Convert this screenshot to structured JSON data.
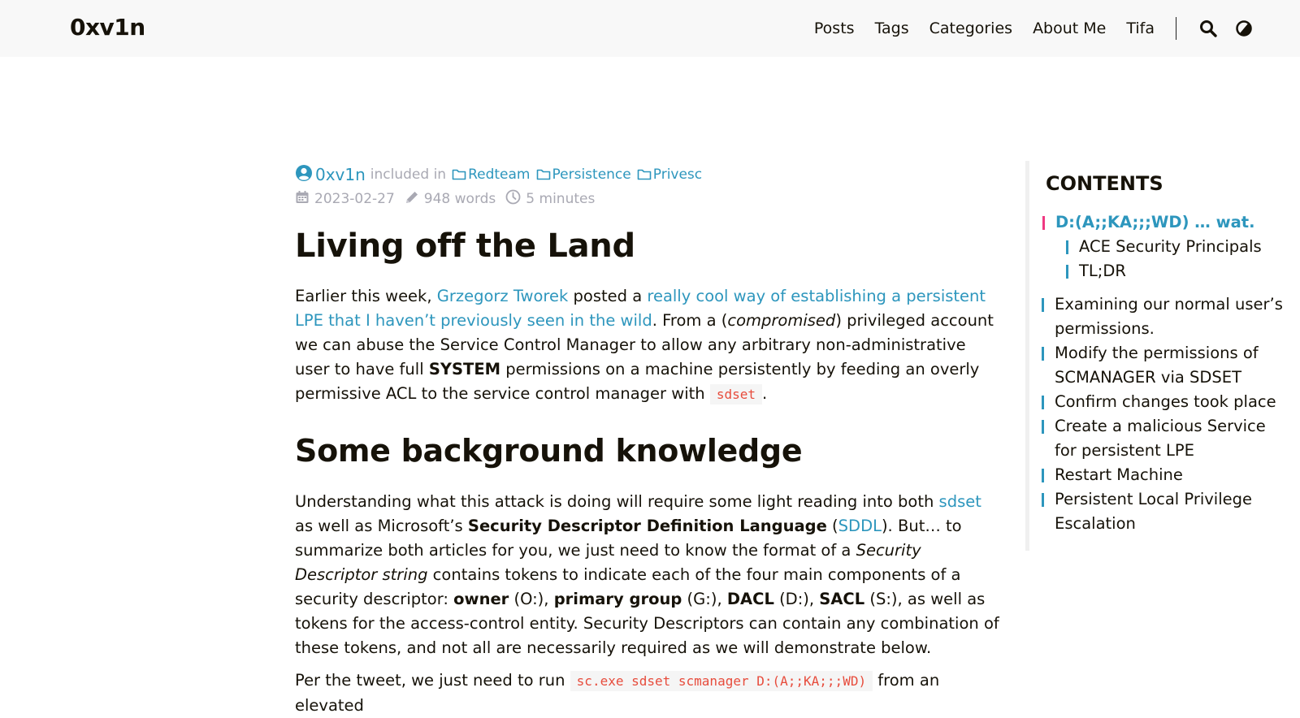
{
  "header": {
    "logo": "0xv1n",
    "menu": [
      "Posts",
      "Tags",
      "Categories",
      "About Me",
      "Tifa"
    ]
  },
  "meta": {
    "author": "0xv1n",
    "included_in": "included in",
    "categories": [
      "Redteam",
      "Persistence",
      "Privesc"
    ],
    "date": "2023-02-27",
    "words": "948 words",
    "reading_time": "5 minutes"
  },
  "article": {
    "title": "Living off the Land",
    "p1": {
      "a": "Earlier this week, ",
      "link1": "Grzegorz Tworek",
      "b": " posted a ",
      "link2": "really cool way of establishing a persistent LPE that I haven’t previously seen in the wild",
      "c": ". From a (",
      "em": "compromised",
      "d": ") privileged account we can abuse the Service Control Manager to allow any arbitrary non-administrative user to have full ",
      "strong": "SYSTEM",
      "e": " permissions on a machine persistently by feeding an overly permissive ACL to the service control manager with ",
      "code": "sdset",
      "f": "."
    },
    "h2": "Some background knowledge",
    "p2": {
      "a": "Understanding what this attack is doing will require some light reading into both ",
      "link1": "sdset",
      "b": " as well as Microsoft’s ",
      "strong1": "Security Descriptor Definition Language",
      "c": " (",
      "link2": "SDDL",
      "d": "). But… to summarize both articles for you, we just need to know the format of a ",
      "em": "Security Descriptor string",
      "e": " contains tokens to indicate each of the four main components of a security descriptor: ",
      "owner": "owner",
      "f": " (O:), ",
      "group": "primary group",
      "g": " (G:), ",
      "dacl": "DACL",
      "h": " (D:), ",
      "sacl": "SACL",
      "i": " (S:), as well as tokens for the access-control entity. Security Descriptors can contain any combination of these tokens, and not all are necessarily required as we will demonstrate below."
    },
    "p3": {
      "a": "Per the tweet, we just need to run ",
      "code": "sc.exe sdset scmanager D:(A;;KA;;;WD)",
      "b": " from an elevated"
    }
  },
  "toc": {
    "title": "CONTENTS",
    "items": [
      {
        "label": "D:(A;;KA;;;WD) … wat.",
        "active": true
      },
      {
        "label": "ACE Security Principals"
      },
      {
        "label": "TL;DR"
      },
      {
        "label": "Examining our normal user’s permissions."
      },
      {
        "label": "Modify the permissions of SCMANAGER via SDSET"
      },
      {
        "label": "Confirm changes took place"
      },
      {
        "label": "Create a malicious Service for persistent LPE"
      },
      {
        "label": "Restart Machine"
      },
      {
        "label": "Persistent Local Privilege Escalation"
      }
    ]
  },
  "colors": {
    "link": "#2d96bd",
    "toc_active_marker": "#ef3982",
    "code_text": "#e74c3c",
    "header_bg": "#f8f8f8",
    "meta_gray": "#a9a9b3"
  }
}
